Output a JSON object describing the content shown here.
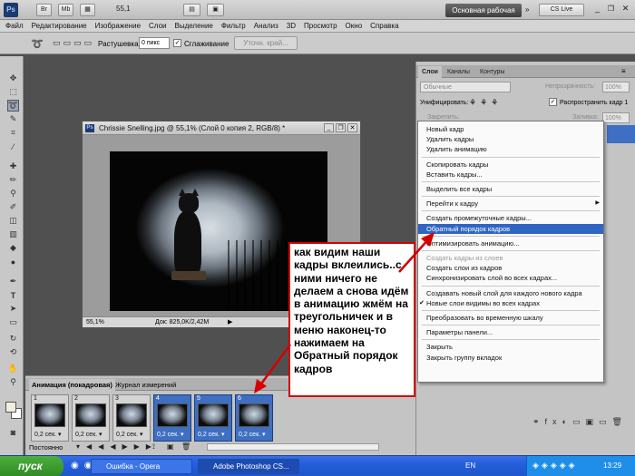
{
  "topbar": {
    "ps_logo": "Ps",
    "br_label": "Br",
    "mb_label": "Mb",
    "zoom_value": "55,1",
    "workspace_label": "Основная рабочая среда",
    "cs_live_label": "CS Live"
  },
  "menubar": [
    "Файл",
    "Редактирование",
    "Изображение",
    "Слои",
    "Выделение",
    "Фильтр",
    "Анализ",
    "3D",
    "Просмотр",
    "Окно",
    "Справка"
  ],
  "options": {
    "feather_label": "Растушевка:",
    "feather_value": "0 пикс",
    "antialias_label": "Сглаживание",
    "refine_label": "Уточн. край..."
  },
  "document": {
    "title": "Chrissie Snelling.jpg @ 55,1% (Слой 0 копия 2, RGB/8) *",
    "zoom": "55,1%",
    "doc_info": "Док: 825,0K/2,42M"
  },
  "layers_panel": {
    "tabs": [
      "Слои",
      "Каналы",
      "Контуры"
    ],
    "blend_mode": "Обычные",
    "opacity_label": "Непрозрачность:",
    "opacity_value": "100%",
    "unify_label": "Унифицировать:",
    "propagate_label": "Распространить кадр 1",
    "lock_label": "Закрепить:",
    "fill_label": "Заливка:",
    "fill_value": "100%"
  },
  "context_menu": {
    "items": [
      {
        "label": "Новый кадр",
        "state": "normal"
      },
      {
        "label": "Удалить кадры",
        "state": "normal"
      },
      {
        "label": "Удалить анимацию",
        "state": "normal"
      },
      {
        "label": "Скопировать кадры",
        "state": "normal"
      },
      {
        "label": "Вставить кадры...",
        "state": "normal"
      },
      {
        "label": "Выделить все кадры",
        "state": "normal"
      },
      {
        "label": "Перейти к кадру",
        "state": "submenu"
      },
      {
        "label": "Создать промежуточные кадры...",
        "state": "normal"
      },
      {
        "label": "Обратный порядок кадров",
        "state": "selected"
      },
      {
        "label": "Оптимизировать анимацию...",
        "state": "normal"
      },
      {
        "label": "Создать кадры из слоев",
        "state": "disabled"
      },
      {
        "label": "Создать слои из кадров",
        "state": "normal"
      },
      {
        "label": "Синхронизировать слой во всех кадрах...",
        "state": "normal"
      },
      {
        "label": "Создавать новый слой для каждого нового кадра",
        "state": "normal"
      },
      {
        "label": "Новые слои видимы во всех кадрах",
        "state": "checked"
      },
      {
        "label": "Преобразовать во временную шкалу",
        "state": "normal"
      },
      {
        "label": "Параметры панели...",
        "state": "normal"
      },
      {
        "label": "Закрыть",
        "state": "normal"
      },
      {
        "label": "Закрыть группу вкладок",
        "state": "normal"
      }
    ],
    "submenu_arrow": "▶",
    "check_mark": "✔"
  },
  "animation_panel": {
    "tabs": [
      "Анимация (покадровая)",
      "Журнал измерений"
    ],
    "frames": [
      {
        "num": "1",
        "delay": "0,2 сек.",
        "selected": false
      },
      {
        "num": "2",
        "delay": "0,2 сек.",
        "selected": false
      },
      {
        "num": "3",
        "delay": "0,2 сек.",
        "selected": false
      },
      {
        "num": "4",
        "delay": "0,2 сек.",
        "selected": true
      },
      {
        "num": "5",
        "delay": "0,2 сек.",
        "selected": true
      },
      {
        "num": "6",
        "delay": "0,2 сек.",
        "selected": true
      }
    ],
    "loop_label": "Постоянно"
  },
  "annotation": {
    "text": "как видим наши кадры вклеились..с ними ничего не делаем а снова идём в анимацию жмём на треугольничек и в меню наконец-то нажимаем на Обратный порядок кадров"
  },
  "taskbar": {
    "start_label": "пуск",
    "tasks": [
      {
        "label": "Ошибка - Opera",
        "active": false
      },
      {
        "label": "Adobe Photoshop CS...",
        "active": true
      }
    ],
    "lang": "EN",
    "time": "13:29"
  },
  "colors": {
    "accent_red": "#d40000",
    "selection_blue": "#3165c4",
    "frame_selected": "#3e6fc2",
    "taskbar_blue": "#245edb"
  }
}
